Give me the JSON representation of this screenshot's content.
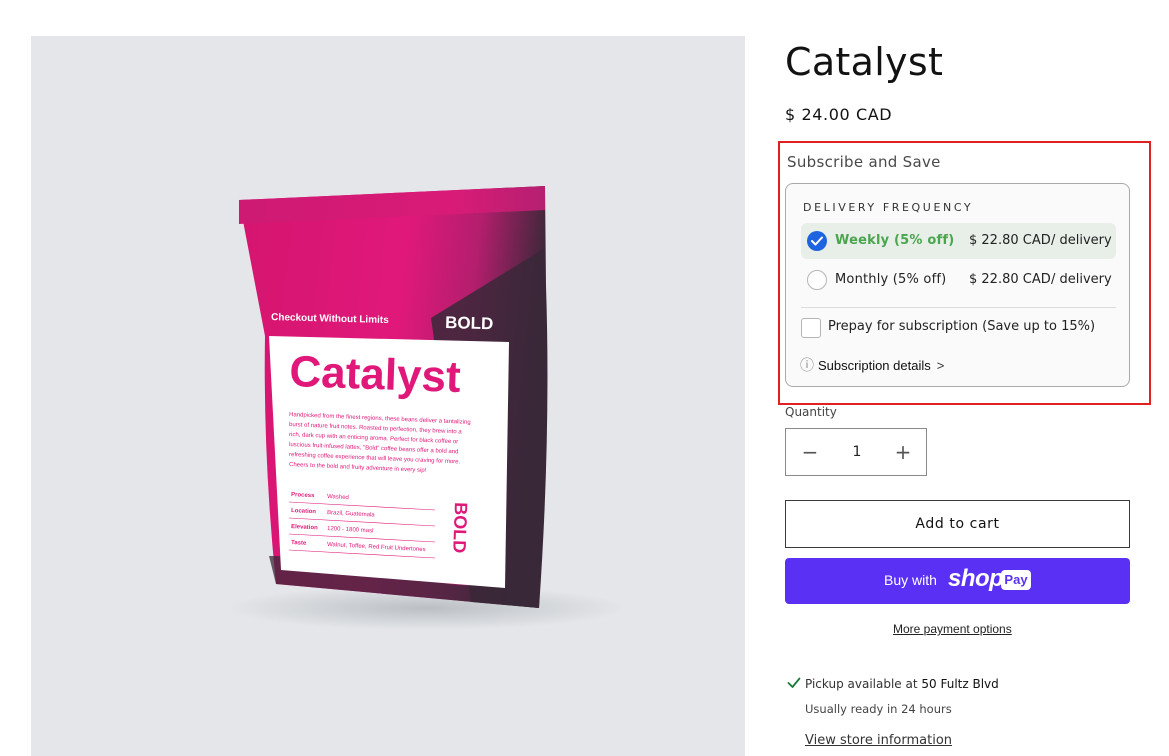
{
  "product": {
    "title": "Catalyst",
    "price": "$ 24.00 CAD"
  },
  "image": {
    "bag_tagline": "Checkout Without Limits",
    "bag_brand": "BOLD",
    "bag_name": "Catalyst",
    "bag_description": [
      "Handpicked from the finest regions, these beans deliver a tantalizing",
      "burst of nature fruit notes. Roasted to perfection, they brew into a",
      "rich, dark cup with an enticing aroma. Perfect for black coffee or",
      "luscious fruit-infused lattes, \"Bold\" coffee beans offer a bold and",
      "refreshing coffee experience that will leave you craving for more.",
      "Cheers to the bold and fruity adventure in every sip!"
    ],
    "specs": [
      {
        "label": "Process",
        "value": "Washed"
      },
      {
        "label": "Location",
        "value": "Brazil, Guatemala"
      },
      {
        "label": "Elevation",
        "value": "1200 - 1800 masl"
      },
      {
        "label": "Taste",
        "value": "Walnut, Toffee, Red Fruit Undertones"
      }
    ],
    "colors": {
      "magenta": "#e0187a",
      "dark": "#3a2838",
      "background": "#e4e6e9"
    }
  },
  "subscription": {
    "heading": "Subscribe and Save",
    "frequency_label": "DELIVERY FREQUENCY",
    "options": [
      {
        "name": "Weekly (5% off)",
        "amount": "$ 22.80 CAD",
        "per": "/ delivery",
        "selected": true
      },
      {
        "name": "Monthly (5% off)",
        "amount": "$ 22.80 CAD",
        "per": "/ delivery",
        "selected": false
      }
    ],
    "prepay_label": "Prepay for subscription (Save up to 15%)",
    "details_label": "Subscription details",
    "info_icon": "ⓘ",
    "chevron": ">",
    "accent_color": "#1e64e0",
    "selected_text_color": "#4aa54e"
  },
  "quantity": {
    "label": "Quantity",
    "value": "1",
    "minus": "−",
    "plus": "+"
  },
  "buttons": {
    "add_to_cart": "Add to cart",
    "buy_with": "Buy with",
    "shop": "shop",
    "pay": "Pay",
    "more_payment": "More payment options",
    "shoppay_color": "#5a31f4"
  },
  "pickup": {
    "text": "Pickup available at",
    "location": "50 Fultz Blvd",
    "ready": "Usually ready in 24 hours",
    "store_link": "View store information"
  }
}
